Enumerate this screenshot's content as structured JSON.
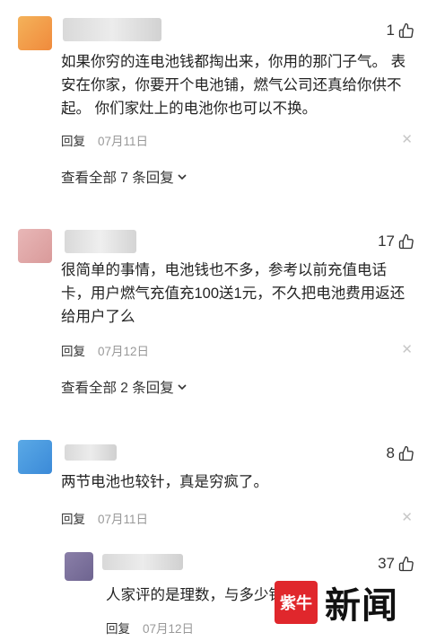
{
  "comments": [
    {
      "likes": "1",
      "text_lines": [
        "如果你穷的连电池钱都掏出来，你用的那门子气。 表",
        "安在你家，你要开个电池铺，燃气公司还真给你供不",
        "起。 你们家灶上的电池你也可以不换。"
      ],
      "reply_label": "回复",
      "date": "07月11日",
      "expand_label": "查看全部 7 条回复"
    },
    {
      "likes": "17",
      "text_lines": [
        "很简单的事情，电池钱也不多，参考以前充值电话",
        "卡，用户燃气充值充100送1元，不久把电池费用返还",
        "给用户了么"
      ],
      "reply_label": "回复",
      "date": "07月12日",
      "expand_label": "查看全部 2 条回复"
    },
    {
      "likes": "8",
      "text_lines": [
        "两节电池也较针，真是穷疯了。"
      ],
      "reply_label": "回复",
      "date": "07月11日"
    },
    {
      "likes": "37",
      "text_lines": [
        "人家评的是理数，与多少钱"
      ],
      "reply_label": "回复",
      "date": "07月12日"
    }
  ],
  "watermark": {
    "seal_text": "紫牛",
    "brand_text": "新闻"
  },
  "icons": {
    "like": "thumbs-up-icon",
    "close": "close-icon",
    "expand": "chevron-down-icon"
  },
  "colors": {
    "seal": "#e0272c",
    "date": "#999999"
  }
}
